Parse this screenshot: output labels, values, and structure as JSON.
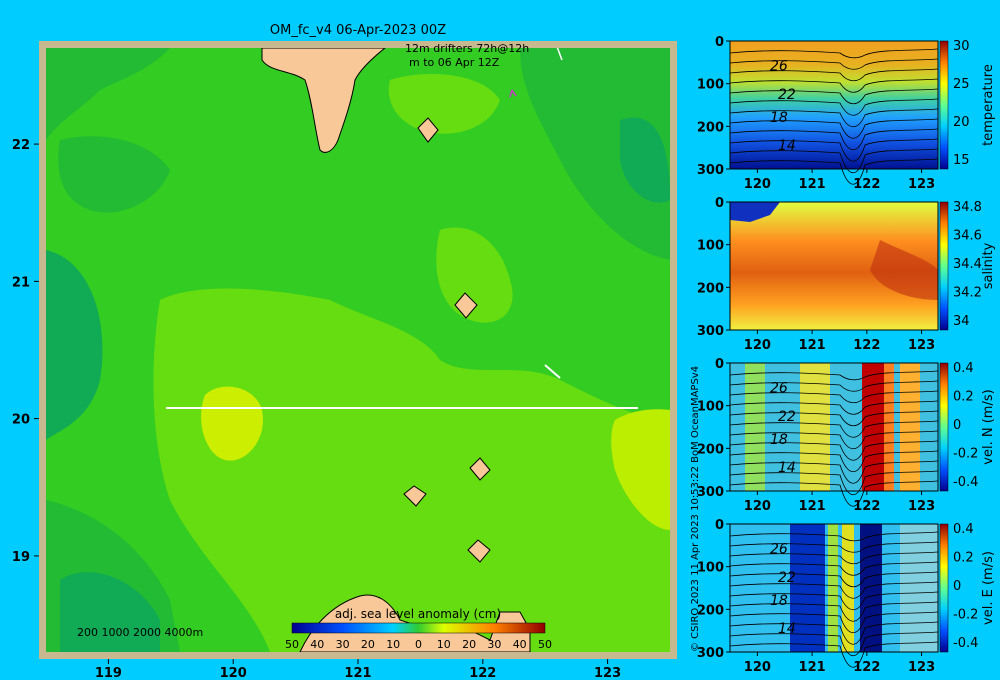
{
  "title": "OM_fc_v4  06-Apr-2023 00Z",
  "credit": "© CSIRO 2023   11 Apr 2023 10:53:22 BoM OceanMAPSv4",
  "drifter_legend": {
    "line1": "12m    drifters 72h@12h",
    "line2": "m        to 06 Apr 12Z"
  },
  "depth_legend": "200  1000  2000  4000m",
  "map": {
    "chart_data": {
      "type": "heatmap",
      "title": "",
      "colorbar_label": "adj. sea level anomaly (cm)",
      "colorbar_ticks": [
        "50",
        "40",
        "30",
        "20",
        "10",
        "0",
        "10",
        "20",
        "30",
        "40",
        "50"
      ],
      "x_ticks": [
        "119",
        "120",
        "121",
        "122",
        "123"
      ],
      "y_ticks": [
        "22",
        "21",
        "20",
        "19"
      ],
      "xlim": [
        118.5,
        123.5
      ],
      "ylim": [
        18.3,
        22.7
      ],
      "section": {
        "lon": [
          119.5,
          123.25
        ],
        "lat": [
          20.0,
          20.0
        ]
      },
      "colors": {
        "land": "#f8c898",
        "background_field": "#33cc22",
        "positive_anomaly": "#ccee00",
        "negative_anomaly": "#00aa66"
      }
    }
  },
  "panels": [
    {
      "id": "temperature",
      "colorbar_label": "temperature",
      "cbar_ticks": [
        "30",
        "25",
        "20",
        "15"
      ],
      "chart_data": {
        "type": "heatmap",
        "x_ticks": [
          "120",
          "121",
          "122",
          "123"
        ],
        "y_ticks": [
          "0",
          "100",
          "200",
          "300"
        ],
        "xlim": [
          119.5,
          123.3
        ],
        "ylim": [
          0,
          300
        ],
        "contour_labels": [
          "26",
          "22",
          "18",
          "14"
        ]
      }
    },
    {
      "id": "salinity",
      "colorbar_label": "salinity",
      "cbar_ticks": [
        "34.8",
        "34.6",
        "34.4",
        "34.2",
        "34"
      ],
      "chart_data": {
        "type": "heatmap",
        "x_ticks": [
          "120",
          "121",
          "122",
          "123"
        ],
        "y_ticks": [
          "0",
          "100",
          "200",
          "300"
        ],
        "xlim": [
          119.5,
          123.3
        ],
        "ylim": [
          0,
          300
        ],
        "contour_labels": []
      }
    },
    {
      "id": "vel_n",
      "colorbar_label": "vel. N (m/s)",
      "cbar_ticks": [
        "0.4",
        "0.2",
        "0",
        "-0.2",
        "-0.4"
      ],
      "chart_data": {
        "type": "heatmap",
        "x_ticks": [
          "120",
          "121",
          "122",
          "123"
        ],
        "y_ticks": [
          "0",
          "100",
          "200",
          "300"
        ],
        "xlim": [
          119.5,
          123.3
        ],
        "ylim": [
          0,
          300
        ],
        "contour_labels": [
          "26",
          "22",
          "18",
          "14"
        ]
      }
    },
    {
      "id": "vel_e",
      "colorbar_label": "vel. E (m/s)",
      "cbar_ticks": [
        "0.4",
        "0.2",
        "0",
        "-0.2",
        "-0.4"
      ],
      "chart_data": {
        "type": "heatmap",
        "x_ticks": [
          "120",
          "121",
          "122",
          "123"
        ],
        "y_ticks": [
          "0",
          "100",
          "200",
          "300"
        ],
        "xlim": [
          119.5,
          123.3
        ],
        "ylim": [
          0,
          300
        ],
        "contour_labels": [
          "26",
          "22",
          "18",
          "14"
        ]
      }
    }
  ]
}
